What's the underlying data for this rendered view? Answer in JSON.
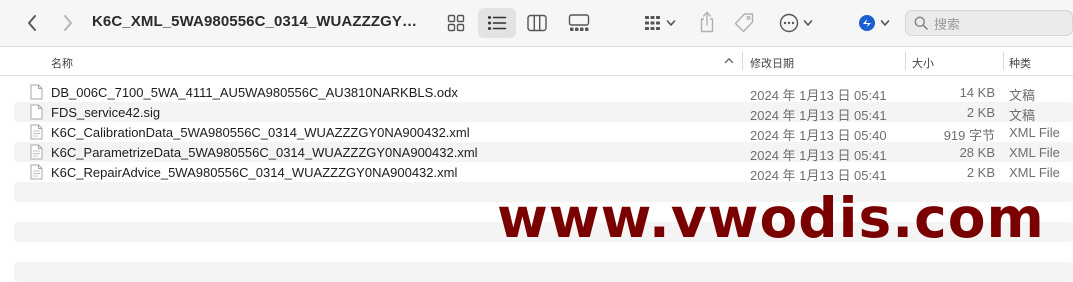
{
  "window": {
    "title": "K6C_XML_5WA980556C_0314_WUAZZZGY…"
  },
  "search": {
    "placeholder": "搜索"
  },
  "columns": {
    "name": "名称",
    "date": "修改日期",
    "size": "大小",
    "kind": "种类"
  },
  "files": [
    {
      "name": "DB_006C_7100_5WA_4111_AU5WA980556C_AU3810NARKBLS.odx",
      "date": "2024 年 1月13 日 05:41",
      "size": "14 KB",
      "kind": "文稿",
      "icon": "document-icon"
    },
    {
      "name": "FDS_service42.sig",
      "date": "2024 年 1月13 日 05:41",
      "size": "2 KB",
      "kind": "文稿",
      "icon": "document-icon"
    },
    {
      "name": "K6C_CalibrationData_5WA980556C_0314_WUAZZZGY0NA900432.xml",
      "date": "2024 年 1月13 日 05:40",
      "size": "919 字节",
      "kind": "XML File",
      "icon": "xml-file-icon"
    },
    {
      "name": "K6C_ParametrizeData_5WA980556C_0314_WUAZZZGY0NA900432.xml",
      "date": "2024 年 1月13 日 05:41",
      "size": "28 KB",
      "kind": "XML File",
      "icon": "xml-file-icon"
    },
    {
      "name": "K6C_RepairAdvice_5WA980556C_0314_WUAZZZGY0NA900432.xml",
      "date": "2024 年 1月13 日 05:41",
      "size": "2 KB",
      "kind": "XML File",
      "icon": "xml-file-icon"
    }
  ],
  "watermark": "www.vwodis.com",
  "colors": {
    "toolbar_bg": "#f6f6f6",
    "stripe": "#f4f4f5",
    "watermark": "#7a0000",
    "accent": "#1a5fd0"
  }
}
